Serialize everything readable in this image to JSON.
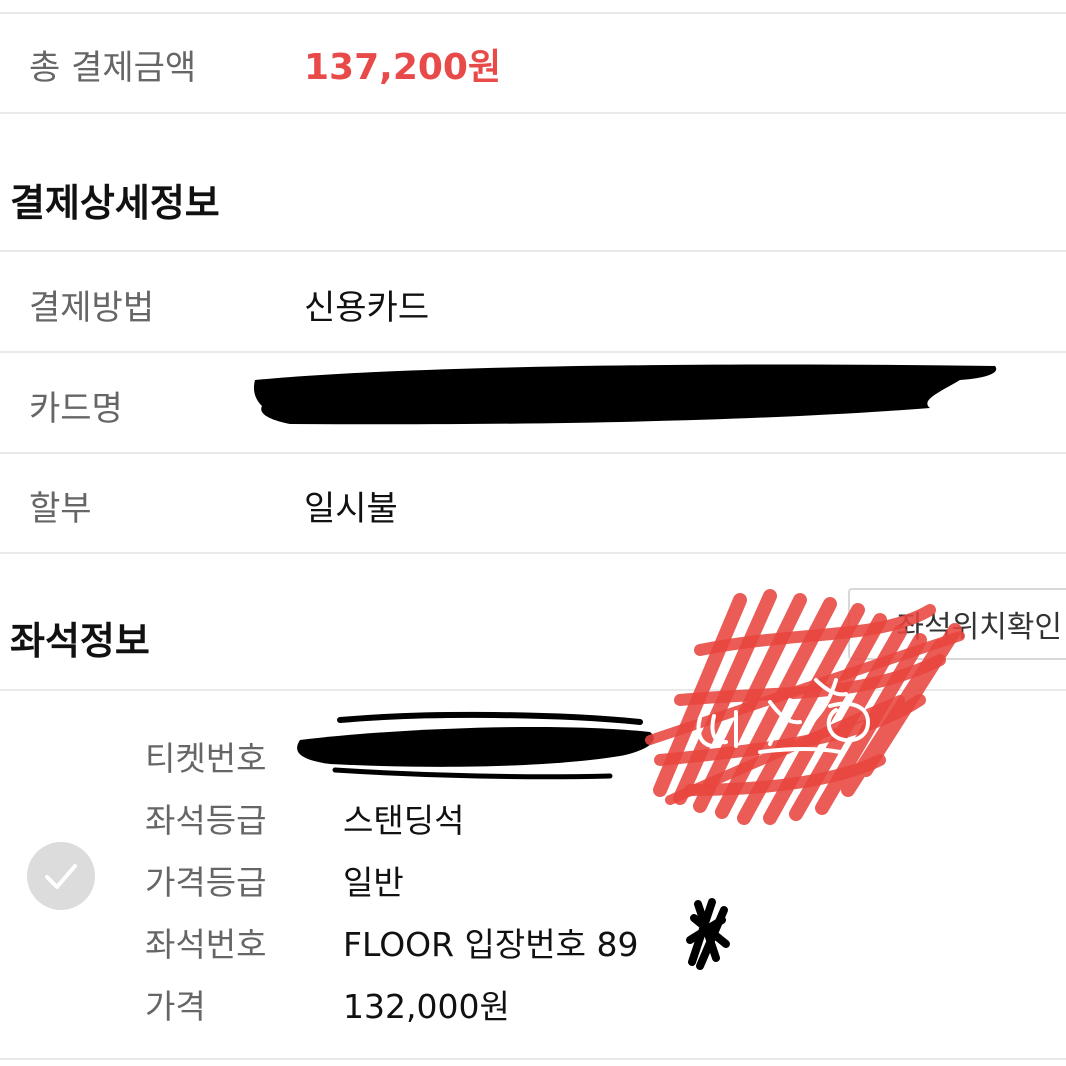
{
  "total": {
    "label": "총 결제금액",
    "value": "137,200원",
    "accent_color": "#e84a4a"
  },
  "payment_detail": {
    "title": "결제상세정보",
    "rows": [
      {
        "label": "결제방법",
        "value": "신용카드"
      },
      {
        "label": "카드명",
        "value": ""
      },
      {
        "label": "할부",
        "value": "일시불"
      }
    ]
  },
  "seat_info": {
    "title": "좌석정보",
    "seat_location_button": "좌석위치확인",
    "ticket": {
      "rows": [
        {
          "label": "티켓번호",
          "value": ""
        },
        {
          "label": "좌석등급",
          "value": "스탠딩석"
        },
        {
          "label": "가격등급",
          "value": "일반"
        },
        {
          "label": "좌석번호",
          "value": "FLOOR 입장번호 89"
        },
        {
          "label": "가격",
          "value": "132,000원"
        }
      ]
    }
  },
  "icons": {
    "ticket_select": "check-circle-icon"
  },
  "overlays": {
    "redaction_color": "#000000",
    "scribble_color": "#e8463f"
  }
}
